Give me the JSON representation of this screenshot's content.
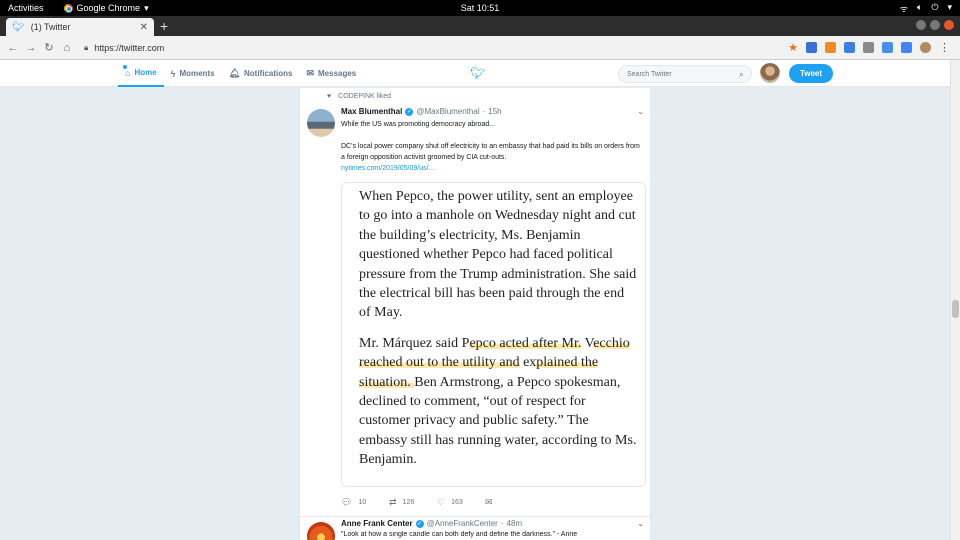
{
  "os_bar": {
    "activities": "Activities",
    "app_name": "Google Chrome",
    "clock": "Sat 10:51",
    "tray": [
      "wifi-icon",
      "volume-icon",
      "power-icon"
    ]
  },
  "browser": {
    "tab_title": "(1) Twitter",
    "new_tab": "+",
    "url": "https://twitter.com"
  },
  "twitter_header": {
    "nav": [
      {
        "label": "Home",
        "icon": "home-icon",
        "active": true
      },
      {
        "label": "Moments",
        "icon": "lightning-icon",
        "active": false
      },
      {
        "label": "Notifications",
        "icon": "bell-icon",
        "active": false
      },
      {
        "label": "Messages",
        "icon": "envelope-icon",
        "active": false
      }
    ],
    "search_placeholder": "Search Twitter",
    "tweet_button": "Tweet",
    "accent": "#1da1f2"
  },
  "tweet1": {
    "context": "CODEPINK liked",
    "name": "Max Blumenthal",
    "handle": "@MaxBlumenthal",
    "separator": "·",
    "time": "15h",
    "text_line1": "While the US was promoting democracy abroad...",
    "text_line2": "DC's local power company shut off electricity to an embassy that had paid its bills on orders from a foreign opposition activist groomed by CIA cut-outs.",
    "link": "nytimes.com/2019/05/09/us/…",
    "card": {
      "para1": "When Pepco, the power utility, sent an employee to go into a manhole on Wednesday night and cut the building’s electricity, Ms. Benjamin questioned whether Pepco had faced political pressure from the Trump administration. She said the electrical bill has been paid through the end of May.",
      "para2_pre": "Mr. Márquez said P",
      "para2_hl1": "epco acted after Mr.",
      "para2_mid1": " V",
      "para2_hl2": "ecchio reached out to the utility and",
      "para2_mid2": " ex",
      "para2_hl3": "plained the situation. ",
      "para2_post": "Ben Armstrong, a Pepco spokesman, declined to comment, “out of respect for customer privacy and public safety.” The embassy still has running water, according to Ms. Benjamin."
    },
    "replies": "10",
    "retweets": "126",
    "likes": "163"
  },
  "tweet2": {
    "name": "Anne Frank Center",
    "handle": "@AnneFrankCenter",
    "separator": "·",
    "time": "48m",
    "text": "\"Look at how a single candle can both defy and define the darkness.\" - Anne"
  }
}
